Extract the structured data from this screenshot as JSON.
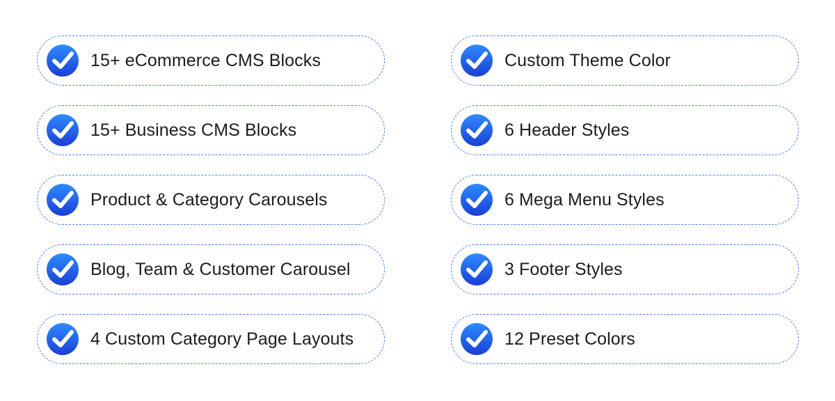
{
  "colors": {
    "border": "#4a7fe8",
    "icon_top": "#2f8bff",
    "icon_bottom": "#1a3fd6",
    "text": "#1c1c1c"
  },
  "icon": "check-circle-icon",
  "features": {
    "left": [
      "15+ eCommerce CMS Blocks",
      "15+ Business CMS Blocks",
      "Product & Category Carousels",
      "Blog, Team & Customer Carousel",
      "4 Custom Category Page Layouts"
    ],
    "right": [
      "Custom Theme Color",
      "6 Header Styles",
      "6 Mega Menu Styles",
      "3 Footer Styles",
      "12 Preset Colors"
    ]
  }
}
